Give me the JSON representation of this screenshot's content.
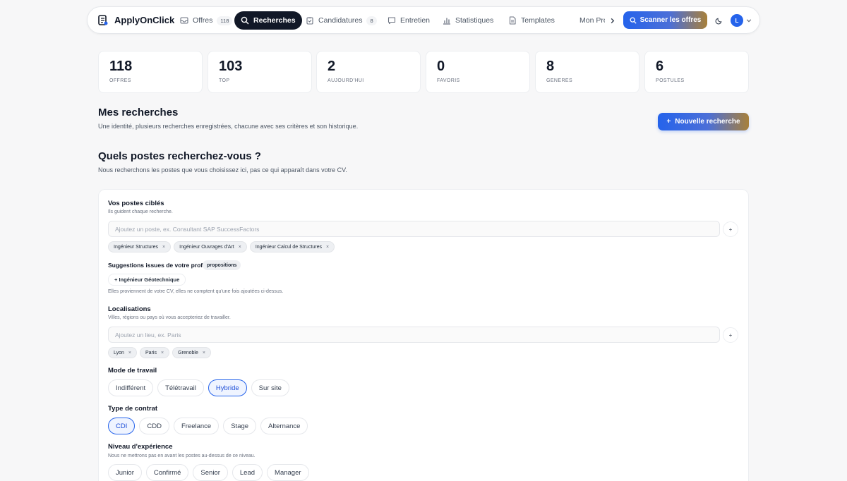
{
  "nav": {
    "brand": "ApplyOnClick",
    "items": [
      {
        "label": "Offres",
        "count": "118",
        "icon": "inbox-icon"
      },
      {
        "label": "Recherches",
        "count": null,
        "icon": "search-icon"
      },
      {
        "label": "Candidatures",
        "count": "8",
        "icon": "clipboard-icon"
      },
      {
        "label": "Entretien",
        "count": null,
        "icon": "message-icon"
      },
      {
        "label": "Statistiques",
        "count": null,
        "icon": "bar-chart-icon"
      },
      {
        "label": "Templates",
        "count": null,
        "icon": "document-icon"
      },
      {
        "label": "Mon Profil",
        "count": null,
        "icon": "user-icon"
      }
    ],
    "active_index": 1,
    "scan_label": "Scanner les offres",
    "avatar_initial": "L"
  },
  "stats": [
    {
      "value": "118",
      "label": "OFFRES"
    },
    {
      "value": "103",
      "label": "TOP"
    },
    {
      "value": "2",
      "label": "AUJOURD'HUI"
    },
    {
      "value": "0",
      "label": "FAVORIS"
    },
    {
      "value": "8",
      "label": "GENERES"
    },
    {
      "value": "6",
      "label": "POSTULES"
    }
  ],
  "searches": {
    "title": "Mes recherches",
    "subtitle": "Une identité, plusieurs recherches enregistrées, chacune avec ses critères et son historique.",
    "new_button": "Nouvelle recherche"
  },
  "question": {
    "title": "Quels postes recherchez-vous ?",
    "subtitle": "Nous recherchons les postes que vous choisissez ici, pas ce qui apparaît dans votre CV."
  },
  "form": {
    "postes": {
      "label": "Vos postes ciblés",
      "help": "Ils guident chaque recherche.",
      "placeholder": "Ajoutez un poste, ex. Consultant SAP SuccessFactors",
      "add": "+",
      "chips": [
        "Ingénieur Structures",
        "Ingénieur Ouvrages d'Art",
        "Ingénieur Calcul de Structures"
      ]
    },
    "suggestions": {
      "label": "Suggestions issues de votre profil",
      "badge": "propositions",
      "items": [
        "+ Ingénieur Géotechnique"
      ],
      "note": "Elles proviennent de votre CV, elles ne comptent qu'une fois ajoutées ci-dessus."
    },
    "localisations": {
      "label": "Localisations",
      "help": "Villes, régions ou pays où vous accepteriez de travailler.",
      "placeholder": "Ajoutez un lieu, ex. Paris",
      "add": "+",
      "chips": [
        "Lyon",
        "Paris",
        "Grenoble"
      ]
    },
    "mode": {
      "label": "Mode de travail",
      "options": [
        "Indifférent",
        "Télétravail",
        "Hybride",
        "Sur site"
      ],
      "selected": "Hybride"
    },
    "contrat": {
      "label": "Type de contrat",
      "options": [
        "CDI",
        "CDD",
        "Freelance",
        "Stage",
        "Alternance"
      ],
      "selected": "CDI"
    },
    "niveau": {
      "label": "Niveau d'expérience",
      "help": "Nous ne mettrons pas en avant les postes au-dessus de ce niveau.",
      "options": [
        "Junior",
        "Confirmé",
        "Senior",
        "Lead",
        "Manager"
      ],
      "selected": null
    }
  },
  "colors": {
    "accent": "#2563eb",
    "dark": "#111827",
    "gradient_end": "#a8803a"
  }
}
